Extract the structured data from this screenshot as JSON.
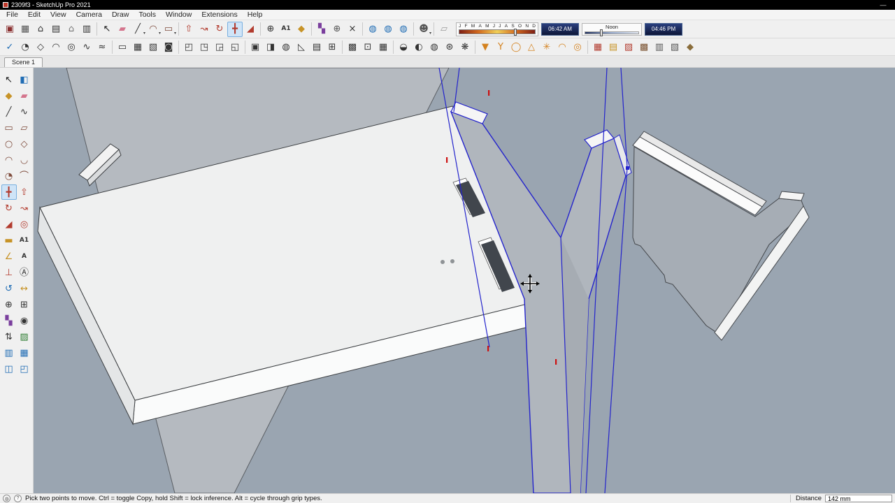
{
  "window": {
    "title": "2309f3 - SketchUp Pro 2021",
    "minimize_glyph": "—"
  },
  "menu": {
    "items": [
      "File",
      "Edit",
      "View",
      "Camera",
      "Draw",
      "Tools",
      "Window",
      "Extensions",
      "Help"
    ]
  },
  "toolbar_top": {
    "shadow": {
      "months": [
        "J",
        "F",
        "M",
        "A",
        "M",
        "J",
        "J",
        "A",
        "S",
        "O",
        "N",
        "D"
      ],
      "time_start": "06:42 AM",
      "time_mid": "Noon",
      "time_end": "04:46 PM"
    },
    "icons_row1": [
      {
        "name": "stamp-icon",
        "glyph": "▣",
        "color": "#8a2f2f"
      },
      {
        "name": "components-stack-icon",
        "glyph": "▦",
        "color": "#555555"
      },
      {
        "name": "home-icon",
        "glyph": "⌂",
        "color": "#333333"
      },
      {
        "name": "print-icon",
        "glyph": "▤",
        "color": "#333333"
      },
      {
        "name": "warehouse-icon",
        "glyph": "⌂",
        "color": "#777777"
      },
      {
        "name": "materials-list-icon",
        "glyph": "▥",
        "color": "#333333"
      },
      {
        "sep": true
      },
      {
        "name": "select-tool",
        "glyph": "↖",
        "color": "#1a1a1a"
      },
      {
        "name": "eraser-tool",
        "glyph": "▰",
        "color": "#d4748c"
      },
      {
        "name": "line-tool",
        "glyph": "╱",
        "color": "#333333",
        "dropdown": true
      },
      {
        "name": "arc-tool",
        "glyph": "◠",
        "color": "#7d4a3a",
        "dropdown": true
      },
      {
        "name": "shapes-tool",
        "glyph": "▭",
        "color": "#7d4a3a",
        "dropdown": true
      },
      {
        "sep": true
      },
      {
        "name": "push-pull-tool",
        "glyph": "⇧",
        "color": "#b23b2e"
      },
      {
        "name": "follow-me-tool",
        "glyph": "↝",
        "color": "#b23b2e"
      },
      {
        "name": "rotate-tool",
        "glyph": "↻",
        "color": "#b23b2e"
      },
      {
        "name": "move-tool",
        "glyph": "╋",
        "color": "#b23b2e",
        "active": true
      },
      {
        "name": "scale-tool",
        "glyph": "◢",
        "color": "#b23b2e"
      },
      {
        "sep": true
      },
      {
        "name": "zoom-window-tool",
        "glyph": "⊕",
        "color": "#333333"
      },
      {
        "name": "dimension-tool",
        "glyph": "A1",
        "color": "#333333",
        "small": true
      },
      {
        "name": "paint-bucket-tool",
        "glyph": "◆",
        "color": "#c79327"
      },
      {
        "sep": true
      },
      {
        "name": "position-camera-tool",
        "glyph": "▚",
        "color": "#7a3e9d"
      },
      {
        "name": "zoom-tool",
        "glyph": "⊕",
        "color": "#555555"
      },
      {
        "name": "delete-icon",
        "glyph": "×",
        "color": "#333333"
      },
      {
        "sep": true
      },
      {
        "name": "classifier-icon-1",
        "glyph": "◍",
        "color": "#1f6cb4"
      },
      {
        "name": "classifier-icon-2",
        "glyph": "◍",
        "color": "#1f6cb4"
      },
      {
        "name": "classifier-icon-3",
        "glyph": "◍",
        "color": "#1f6cb4"
      },
      {
        "sep": true
      },
      {
        "name": "person-icon",
        "glyph": "☻",
        "color": "#555555",
        "dropdown": true
      },
      {
        "sep": true
      },
      {
        "name": "big-eraser-icon",
        "glyph": "▱",
        "color": "#999999"
      }
    ],
    "icons_row2": [
      {
        "name": "validate-check-icon",
        "glyph": "✓",
        "color": "#1f6cb4"
      },
      {
        "name": "circle-quarter-icon",
        "glyph": "◔",
        "color": "#333333"
      },
      {
        "name": "polygon-outline-icon",
        "glyph": "◇",
        "color": "#333333"
      },
      {
        "name": "curve-icon",
        "glyph": "◠",
        "color": "#333333"
      },
      {
        "name": "spiral-icon",
        "glyph": "◎",
        "color": "#333333"
      },
      {
        "name": "sine-icon",
        "glyph": "∿",
        "color": "#333333"
      },
      {
        "name": "bezier-icon",
        "glyph": "≈",
        "color": "#333333"
      },
      {
        "sep": true
      },
      {
        "name": "text-box-icon",
        "glyph": "▭",
        "color": "#333333"
      },
      {
        "name": "table-icon",
        "glyph": "▦",
        "color": "#333333"
      },
      {
        "name": "image-frame-icon",
        "glyph": "▧",
        "color": "#333333"
      },
      {
        "name": "lock-icon",
        "glyph": "◙",
        "color": "#333333"
      },
      {
        "sep": true
      },
      {
        "name": "rect-corner-icon-1",
        "glyph": "◰",
        "color": "#333333"
      },
      {
        "name": "rect-corner-icon-2",
        "glyph": "◳",
        "color": "#333333"
      },
      {
        "name": "rect-corner-icon-3",
        "glyph": "◲",
        "color": "#333333"
      },
      {
        "name": "rect-corner-icon-4",
        "glyph": "◱",
        "color": "#333333"
      },
      {
        "sep": true
      },
      {
        "name": "box-icon",
        "glyph": "▣",
        "color": "#333333"
      },
      {
        "name": "cube-icon",
        "glyph": "◨",
        "color": "#333333"
      },
      {
        "name": "cylinder-icon",
        "glyph": "◍",
        "color": "#333333"
      },
      {
        "name": "prism-icon",
        "glyph": "◺",
        "color": "#333333"
      },
      {
        "name": "mesh-icon",
        "glyph": "▤",
        "color": "#333333"
      },
      {
        "name": "grid-icon",
        "glyph": "⊞",
        "color": "#333333"
      },
      {
        "sep": true
      },
      {
        "name": "pattern-icon",
        "glyph": "▩",
        "color": "#333333"
      },
      {
        "name": "dice-icon",
        "glyph": "⊡",
        "color": "#333333"
      },
      {
        "name": "cells-icon",
        "glyph": "▦",
        "color": "#333333"
      },
      {
        "sep": true
      },
      {
        "name": "half-circle-icon",
        "glyph": "◒",
        "color": "#333333"
      },
      {
        "name": "contrast-icon",
        "glyph": "◐",
        "color": "#333333"
      },
      {
        "name": "dotted-circle-icon",
        "glyph": "◍",
        "color": "#333333"
      },
      {
        "name": "asterisk-circle-icon",
        "glyph": "⊛",
        "color": "#333333"
      },
      {
        "name": "flower-icon",
        "glyph": "❋",
        "color": "#333333"
      },
      {
        "sep": true
      },
      {
        "name": "funnel-icon",
        "glyph": "▼",
        "color": "#d4821f"
      },
      {
        "name": "goblet-icon",
        "glyph": "Y",
        "color": "#d4821f"
      },
      {
        "name": "ring-icon",
        "glyph": "◯",
        "color": "#d4821f"
      },
      {
        "name": "triangle-icon",
        "glyph": "△",
        "color": "#d4821f"
      },
      {
        "name": "sun-icon",
        "glyph": "✳",
        "color": "#d4821f"
      },
      {
        "name": "dome-icon",
        "glyph": "◠",
        "color": "#d4821f"
      },
      {
        "name": "target-icon",
        "glyph": "◎",
        "color": "#d4821f"
      },
      {
        "sep": true
      },
      {
        "name": "material-swatch-icon",
        "glyph": "▦",
        "color": "#b23b2e"
      },
      {
        "name": "materials-book-icon",
        "glyph": "▤",
        "color": "#c79327"
      },
      {
        "name": "fabric-swatch-icon",
        "glyph": "▨",
        "color": "#b23b2e"
      },
      {
        "name": "texture-icon",
        "glyph": "▩",
        "color": "#7a5230"
      },
      {
        "name": "paint-panel-icon",
        "glyph": "▥",
        "color": "#555555"
      },
      {
        "name": "kit-box-icon",
        "glyph": "▧",
        "color": "#555555"
      },
      {
        "name": "diamond-plate-icon",
        "glyph": "◆",
        "color": "#8a6d3b"
      }
    ]
  },
  "scenes": {
    "tab": "Scene 1"
  },
  "left_toolbar": {
    "tools": [
      {
        "name": "select-tool",
        "glyph": "↖",
        "color": "#1a1a1a"
      },
      {
        "name": "make-component-tool",
        "glyph": "◧",
        "color": "#1f6cb4"
      },
      {
        "name": "paint-bucket-tool",
        "glyph": "◆",
        "color": "#c79327"
      },
      {
        "name": "eraser-tool",
        "glyph": "▰",
        "color": "#d4748c"
      },
      {
        "name": "line-tool",
        "glyph": "╱",
        "color": "#333333"
      },
      {
        "name": "freehand-tool",
        "glyph": "∿",
        "color": "#333333"
      },
      {
        "name": "rectangle-tool",
        "glyph": "▭",
        "color": "#7d4a3a"
      },
      {
        "name": "rotated-rectangle-tool",
        "glyph": "▱",
        "color": "#7d4a3a"
      },
      {
        "name": "circle-tool",
        "glyph": "○",
        "color": "#7d4a3a"
      },
      {
        "name": "polygon-tool",
        "glyph": "◇",
        "color": "#7d4a3a"
      },
      {
        "name": "arc-tool",
        "glyph": "◠",
        "color": "#7d4a3a"
      },
      {
        "name": "three-point-arc-tool",
        "glyph": "◡",
        "color": "#7d4a3a"
      },
      {
        "name": "pie-tool",
        "glyph": "◔",
        "color": "#7d4a3a"
      },
      {
        "name": "two-point-arc-tool",
        "glyph": "⌒",
        "color": "#7d4a3a"
      },
      {
        "name": "move-tool",
        "glyph": "╋",
        "color": "#b23b2e",
        "active": true
      },
      {
        "name": "push-pull-tool",
        "glyph": "⇧",
        "color": "#b23b2e"
      },
      {
        "name": "rotate-tool",
        "glyph": "↻",
        "color": "#b23b2e"
      },
      {
        "name": "follow-me-tool",
        "glyph": "↝",
        "color": "#b23b2e"
      },
      {
        "name": "scale-tool",
        "glyph": "◢",
        "color": "#b23b2e"
      },
      {
        "name": "offset-tool",
        "glyph": "◎",
        "color": "#b23b2e"
      },
      {
        "name": "tape-measure-tool",
        "glyph": "▬",
        "color": "#c79327"
      },
      {
        "name": "dimension-tool",
        "glyph": "A1",
        "color": "#333333",
        "small": true
      },
      {
        "name": "protractor-tool",
        "glyph": "∠",
        "color": "#c79327"
      },
      {
        "name": "text-tool",
        "glyph": "A",
        "color": "#333333",
        "small": true
      },
      {
        "name": "axes-tool",
        "glyph": "⊥",
        "color": "#b23b2e"
      },
      {
        "name": "three-d-text-tool",
        "glyph": "Ⓐ",
        "color": "#333333"
      },
      {
        "name": "orbit-tool",
        "glyph": "↺",
        "color": "#1f6cb4"
      },
      {
        "name": "pan-tool",
        "glyph": "↔",
        "color": "#c79327"
      },
      {
        "name": "zoom-tool",
        "glyph": "⊕",
        "color": "#333333"
      },
      {
        "name": "zoom-extents-tool",
        "glyph": "⊞",
        "color": "#333333"
      },
      {
        "name": "position-camera-tool",
        "glyph": "▚",
        "color": "#7a3e9d"
      },
      {
        "name": "look-around-tool",
        "glyph": "◉",
        "color": "#333333"
      },
      {
        "name": "walk-tool",
        "glyph": "⇅",
        "color": "#333333"
      },
      {
        "name": "section-plane-tool",
        "glyph": "▨",
        "color": "#2e7d32"
      },
      {
        "name": "back-edges-icon",
        "glyph": "▥",
        "color": "#1f6cb4"
      },
      {
        "name": "section-fill-icon",
        "glyph": "▦",
        "color": "#1f6cb4"
      },
      {
        "name": "section-display-icon",
        "glyph": "◫",
        "color": "#1f6cb4"
      },
      {
        "name": "section-cuts-icon",
        "glyph": "◰",
        "color": "#1f6cb4"
      }
    ]
  },
  "viewport": {
    "background_color": "#9aa5b1",
    "selection_color": "#2424cc",
    "face_white": "#eff0f0",
    "face_gray": "#b5bac0",
    "leg_gray": "#b0b6bd",
    "bracket_gray": "#a6adb5",
    "axis_tick_color": "#cc1111"
  },
  "statusbar": {
    "hint": "Pick two points to move.  Ctrl = toggle Copy, hold Shift = lock inference. Alt = cycle through grip types.",
    "distance_label": "Distance",
    "distance_value": "142 mm",
    "help_glyph": "?",
    "geo_glyph": "◍"
  }
}
